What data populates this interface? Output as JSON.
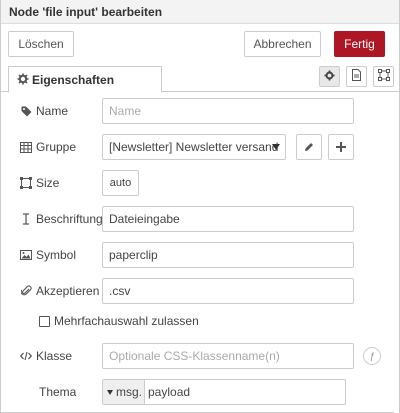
{
  "dialog": {
    "title": "Node 'file input' bearbeiten"
  },
  "buttons": {
    "delete": "Löschen",
    "cancel": "Abbrechen",
    "done": "Fertig"
  },
  "tabs": {
    "properties": "Eigenschaften",
    "icons": [
      "gear-icon",
      "description-icon",
      "appearance-icon"
    ]
  },
  "fields": {
    "name": {
      "label": "Name",
      "placeholder": "Name",
      "value": ""
    },
    "group": {
      "label": "Gruppe",
      "value": "[Newsletter] Newsletter versand"
    },
    "size": {
      "label": "Size",
      "value": "auto"
    },
    "label": {
      "label": "Beschriftung",
      "value": "Dateieingabe"
    },
    "icon": {
      "label": "Symbol",
      "value": "paperclip"
    },
    "accept": {
      "label": "Akzeptieren",
      "value": ".csv"
    },
    "multiple": {
      "label": "Mehrfachauswahl zulassen",
      "checked": false
    },
    "class": {
      "label": "Klasse",
      "placeholder": "Optionale CSS-Klassenname(n)",
      "value": ""
    },
    "topic": {
      "label": "Thema",
      "type": "msg.",
      "value": "payload"
    }
  },
  "colors": {
    "primary": "#ad1625",
    "border": "#cccccc",
    "title_bg": "#f3f3f3"
  }
}
